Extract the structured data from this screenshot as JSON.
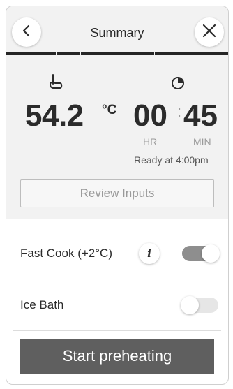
{
  "header": {
    "title": "Summary",
    "back_icon": "chevron-left-icon",
    "close_icon": "close-icon"
  },
  "summary": {
    "temperature_value": "54.2",
    "temperature_unit": "°C",
    "temperature_icon": "probe-icon",
    "time_hours": "00",
    "time_separator": ":",
    "time_minutes": "45",
    "hours_label": "HR",
    "minutes_label": "MIN",
    "clock_icon": "clock-icon",
    "ready_text": "Ready at 4:00pm",
    "review_button_label": "Review Inputs"
  },
  "options": {
    "fast_cook": {
      "label": "Fast Cook (+2°C)",
      "info_icon": "info-icon",
      "info_glyph": "i",
      "enabled": true
    },
    "ice_bath": {
      "label": "Ice Bath",
      "enabled": false
    }
  },
  "actions": {
    "start_label": "Start preheating"
  },
  "colors": {
    "panel_bg": "#f2f2f2",
    "primary_button": "#5f5f5f",
    "toggle_on": "#8e8e8e",
    "toggle_off": "#e6e6e6"
  }
}
